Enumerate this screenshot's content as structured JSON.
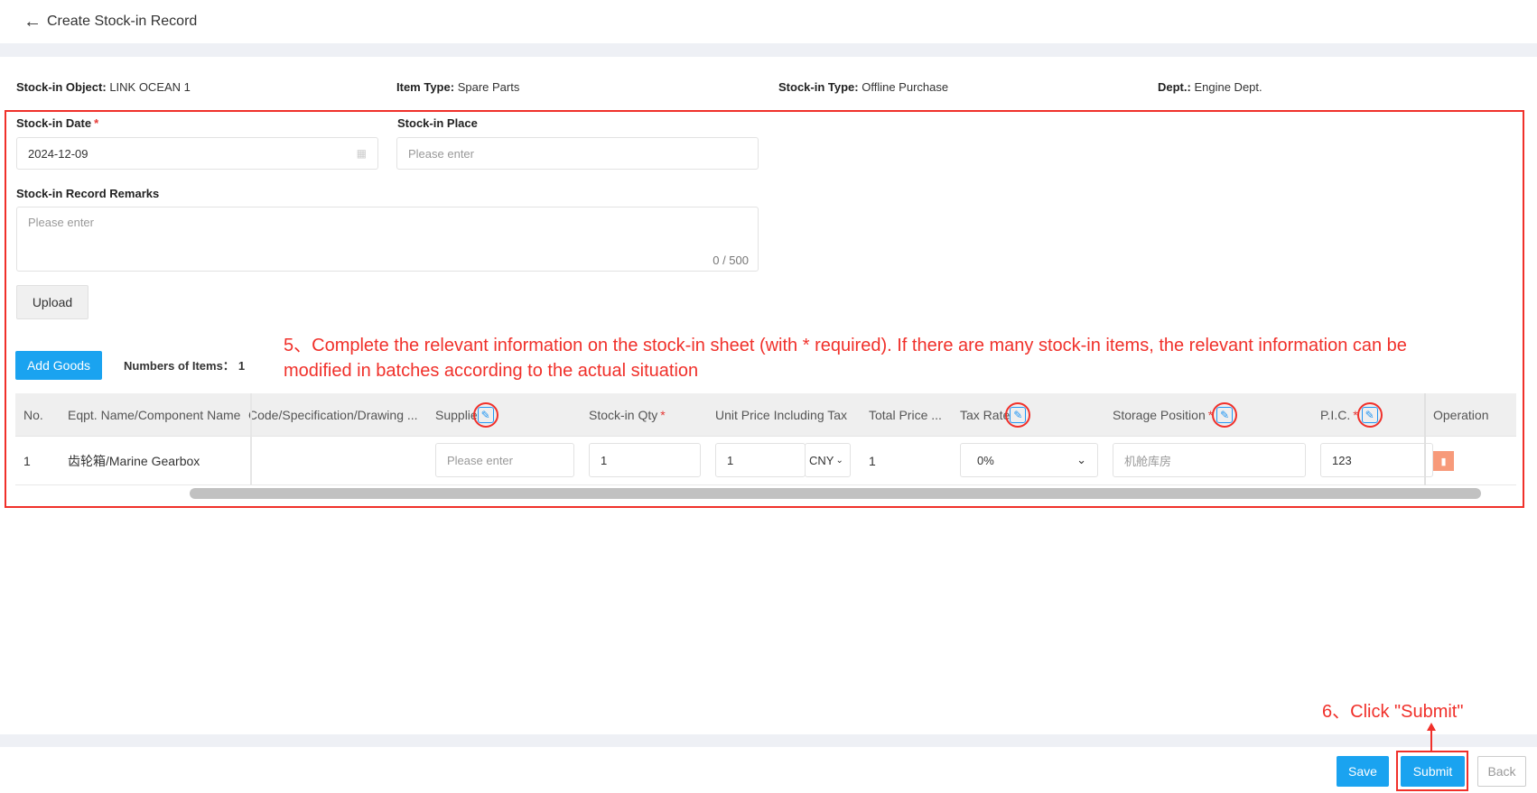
{
  "header": {
    "title": "Create Stock-in Record",
    "back_icon": "arrow-left-icon"
  },
  "info": [
    {
      "label": "Stock-in Object:",
      "value": "LINK OCEAN 1"
    },
    {
      "label": "Item Type:",
      "value": "Spare Parts"
    },
    {
      "label": "Stock-in Type:",
      "value": "Offline Purchase"
    },
    {
      "label": "Dept.:",
      "value": "Engine Dept."
    }
  ],
  "form": {
    "date_label": "Stock-in Date",
    "date_required": "*",
    "date_value": "2024-12-09",
    "place_label": "Stock-in Place",
    "place_placeholder": "Please enter",
    "remarks_label": "Stock-in Record Remarks",
    "remarks_placeholder": "Please enter",
    "remarks_count": "0 / 500",
    "upload_label": "Upload"
  },
  "goods": {
    "add_label": "Add Goods",
    "count_label": "Numbers of Items：",
    "count": "1"
  },
  "table": {
    "headers": [
      "No.",
      "Eqpt. Name/Component Name",
      "Code/Specification/Drawing ...",
      "Supplie",
      "Stock-in Qty",
      "Unit Price Including Tax",
      "Total Price ...",
      "Tax Rate",
      "Storage Position",
      "P.I.C.",
      "Operation"
    ],
    "required_mark": "*",
    "row": {
      "no": "1",
      "name": "齿轮箱/Marine Gearbox",
      "code": "",
      "supplier_placeholder": "Please enter",
      "qty": "1",
      "unit_price": "1",
      "currency": "CNY",
      "total": "1",
      "tax_rate": "0%",
      "storage_placeholder": "机舱库房",
      "pic": "123"
    }
  },
  "annotations": {
    "step5_line1": "5、Complete the relevant information on the stock-in sheet (with * required). If there are many stock-in items, the relevant information can be",
    "step5_line2": "modified in batches according to the actual situation",
    "step6": "6、Click \"Submit\"",
    "color": "#f0302a"
  },
  "footer": {
    "save": "Save",
    "submit": "Submit",
    "back": "Back"
  },
  "colors": {
    "primary": "#1aa3f0",
    "danger": "#f79a7a"
  }
}
